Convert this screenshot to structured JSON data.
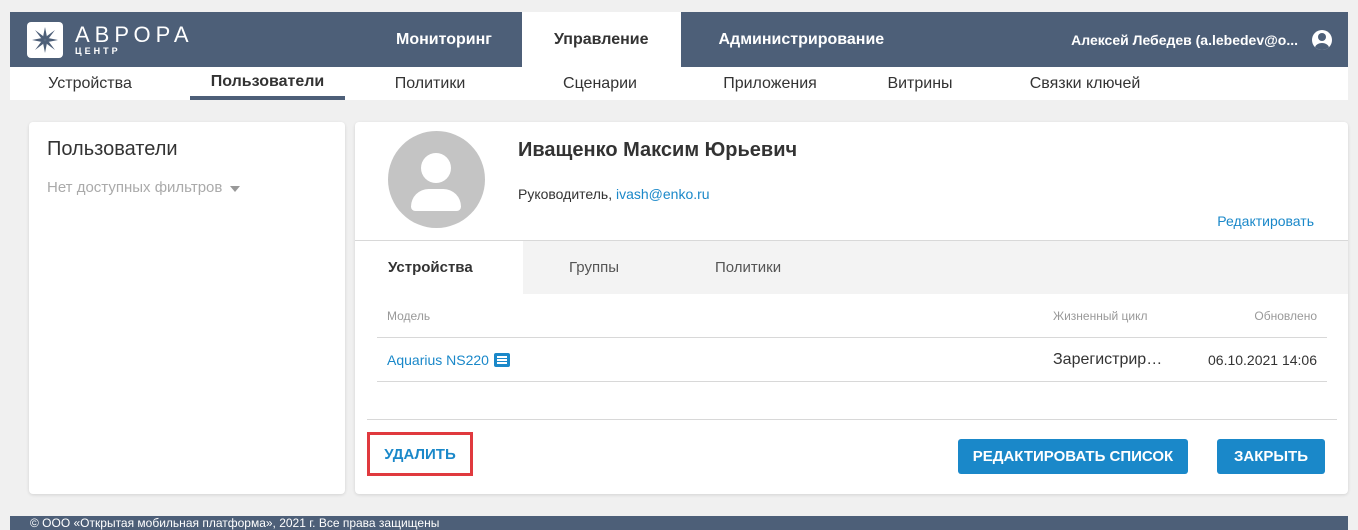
{
  "header": {
    "logo_name": "АВРОРА",
    "logo_sub": "ЦЕНТР",
    "nav": [
      "Мониторинг",
      "Управление",
      "Администрирование"
    ],
    "user": "Алексей Лебедев (a.lebedev@o..."
  },
  "subnav": [
    "Устройства",
    "Пользователи",
    "Политики",
    "Сценарии",
    "Приложения",
    "Витрины",
    "Связки ключей"
  ],
  "left_panel": {
    "title": "Пользователи",
    "filters": "Нет доступных фильтров"
  },
  "profile": {
    "name": "Иващенко Максим Юрьевич",
    "role": "Руководитель, ",
    "email": "ivash@enko.ru",
    "edit": "Редактировать"
  },
  "tabs": [
    "Устройства",
    "Группы",
    "Политики"
  ],
  "table": {
    "headers": {
      "model": "Модель",
      "lifecycle": "Жизненный цикл",
      "updated": "Обновлено"
    },
    "rows": [
      {
        "model": "Aquarius NS220",
        "lifecycle": "Зарегистрировано",
        "updated": "06.10.2021 14:06"
      }
    ]
  },
  "actions": {
    "delete": "УДАЛИТЬ",
    "edit_list": "РЕДАКТИРОВАТЬ СПИСОК",
    "close": "ЗАКРЫТЬ"
  },
  "footer": "© ООО «Открытая мобильная платформа», 2021 г. Все права защищены",
  "colors": {
    "brand": "#4d5f78",
    "accent": "#1a88c9",
    "highlight": "#e0393e"
  }
}
